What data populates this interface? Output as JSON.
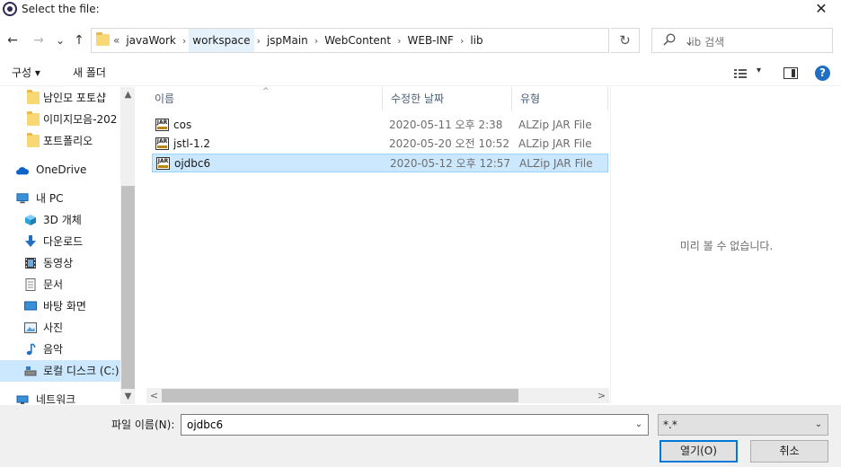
{
  "window": {
    "title": "Select the file:",
    "close_glyph": "✕"
  },
  "navigation": {
    "back": "←",
    "forward": "→",
    "recent": "⌄",
    "up": "↑"
  },
  "address": {
    "lead": "«",
    "crumbs": [
      "javaWork",
      "workspace",
      "jspMain",
      "WebContent",
      "WEB-INF",
      "lib"
    ],
    "separator": "›",
    "dropdown": "⌄",
    "refresh": "↻"
  },
  "search": {
    "placeholder": "lib 검색"
  },
  "commands": {
    "organize": "구성 ▾",
    "new_folder": "새 폴더",
    "view_caret": "▾",
    "help": "?"
  },
  "nav_pane": {
    "items": [
      {
        "label": "남인모 포토샵",
        "icon": "folder-icon"
      },
      {
        "label": "이미지모음-202",
        "icon": "folder-icon"
      },
      {
        "label": "포트폴리오",
        "icon": "folder-icon"
      },
      {
        "label": "OneDrive",
        "icon": "cloud-icon"
      },
      {
        "label": "내 PC",
        "icon": "computer-icon"
      },
      {
        "label": "3D 개체",
        "icon": "cube-icon"
      },
      {
        "label": "다운로드",
        "icon": "download-icon"
      },
      {
        "label": "동영상",
        "icon": "video-icon"
      },
      {
        "label": "문서",
        "icon": "document-icon"
      },
      {
        "label": "바탕 화면",
        "icon": "desktop-icon"
      },
      {
        "label": "사진",
        "icon": "picture-icon"
      },
      {
        "label": "음악",
        "icon": "music-icon"
      },
      {
        "label": "로컬 디스크 (C:)",
        "icon": "drive-icon"
      },
      {
        "label": "네트워크",
        "icon": "network-icon"
      }
    ],
    "selected": "로컬 디스크 (C:)",
    "scroll_up": "▲",
    "scroll_down": "▼"
  },
  "file_list": {
    "columns": {
      "name": "이름",
      "modified": "수정한 날짜",
      "type": "유형"
    },
    "sort_caret": "^",
    "files": [
      {
        "name": "cos",
        "modified": "2020-05-11 오후 2:38",
        "type": "ALZip JAR File",
        "icon": "jar-file-icon"
      },
      {
        "name": "jstl-1.2",
        "modified": "2020-05-20 오전 10:52",
        "type": "ALZip JAR File",
        "icon": "jar-file-icon"
      },
      {
        "name": "ojdbc6",
        "modified": "2020-05-12 오후 12:57",
        "type": "ALZip JAR File",
        "icon": "jar-file-icon"
      }
    ],
    "selected": "ojdbc6",
    "scroll_left": "<",
    "scroll_right": ">"
  },
  "preview": {
    "message": "미리 볼 수 없습니다."
  },
  "bottom": {
    "filename_label": "파일 이름(N):",
    "filename_value": "ojdbc6",
    "filter_value": "*.*",
    "caret": "⌄",
    "open_label": "열기(O)",
    "cancel_label": "취소"
  },
  "colors": {
    "selection": "#cce8ff",
    "selection_border": "#99d1ff",
    "accent": "#0078d7",
    "folder": "#f8d775"
  }
}
